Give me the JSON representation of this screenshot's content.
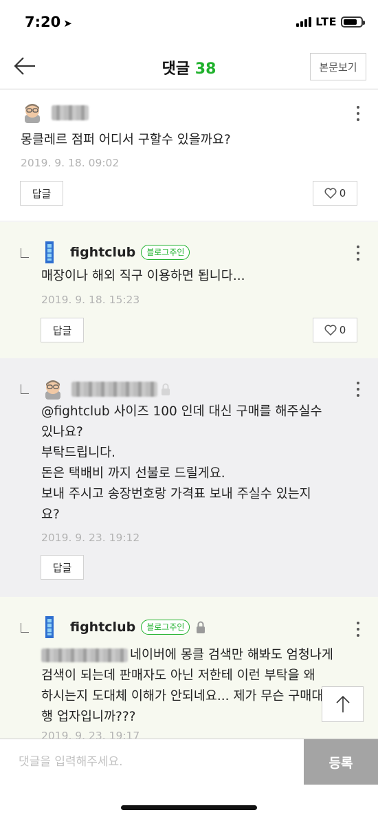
{
  "status_bar": {
    "time": "7:20",
    "network": "LTE"
  },
  "header": {
    "title": "댓글",
    "count": "38",
    "view_post_label": "본문보기"
  },
  "comments": [
    {
      "text": "몽클레르 점퍼 어디서 구할수 있을까요?",
      "date": "2019. 9. 18. 09:02",
      "reply_label": "답글",
      "likes": "0"
    },
    {
      "author": "fightclub",
      "badge": "블로그주인",
      "text": "매장이나 해외 직구 이용하면 됩니다...",
      "date": "2019. 9. 18. 15:23",
      "reply_label": "답글",
      "likes": "0"
    },
    {
      "lines": [
        "@fightclub 사이즈 100 인데 대신 구매를 해주실수",
        "있나요?",
        "부탁드립니다.",
        "돈은 택배비 까지 선불로 드릴게요.",
        "보내  주시고 송장번호랑 가격표 보내 주실수 있는지",
        "요?"
      ],
      "date": "2019. 9. 23. 19:12",
      "reply_label": "답글"
    },
    {
      "author": "fightclub",
      "badge": "블로그주인",
      "lines": [
        "네이버에 몽클 검색만 해봐도 엄청나게",
        "검색이 되는데 판매자도 아닌 저한테 이런 부탁을 왜",
        "하시는지 도대체 이해가 안되네요... 제가 무슨 구매대",
        "행 업자입니까???"
      ],
      "date": "2019. 9. 23. 19:17"
    }
  ],
  "input": {
    "placeholder": "댓글을 입력해주세요.",
    "submit_label": "등록"
  },
  "colors": {
    "accent_green": "#1fb12c",
    "submit_gray": "#a4a4a4",
    "owner_reply_bg": "#f7f9f0",
    "gray_reply_bg": "#f0f0f2"
  }
}
